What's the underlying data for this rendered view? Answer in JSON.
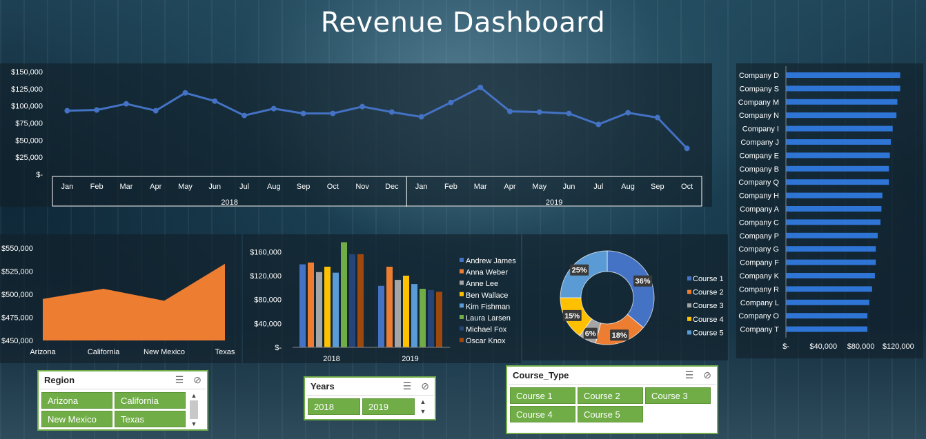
{
  "title": "Revenue Dashboard",
  "colors": {
    "line": "#4472c4",
    "area": "#ed7d31",
    "bars": [
      "#4472c4",
      "#ed7d31",
      "#a5a5a5",
      "#ffc000",
      "#5b9bd5",
      "#70ad47",
      "#264478",
      "#9e480e"
    ],
    "slicer_button": "#70ad47",
    "company_bar": "#2e75d6"
  },
  "line_chart": {
    "type": "line",
    "y_ticks": [
      "$150,000",
      "$125,000",
      "$100,000",
      "$75,000",
      "$50,000",
      "$25,000",
      "$-"
    ],
    "ylim": [
      0,
      150000
    ],
    "months": [
      "Jan",
      "Feb",
      "Mar",
      "Apr",
      "May",
      "Jun",
      "Jul",
      "Aug",
      "Sep",
      "Oct",
      "Nov",
      "Dec",
      "Jan",
      "Feb",
      "Mar",
      "Apr",
      "May",
      "Jun",
      "Jul",
      "Aug",
      "Sep",
      "Oct"
    ],
    "years": [
      "2018",
      "2019"
    ],
    "values": [
      93000,
      94000,
      103000,
      93000,
      119000,
      107000,
      86000,
      96000,
      89000,
      89000,
      99000,
      91000,
      84000,
      105000,
      127000,
      92000,
      91000,
      89000,
      73000,
      90000,
      83000,
      38000
    ]
  },
  "area_chart": {
    "type": "area",
    "y_ticks": [
      "$550,000",
      "$525,000",
      "$500,000",
      "$475,000",
      "$450,000"
    ],
    "ylim": [
      450000,
      550000
    ],
    "categories": [
      "Arizona",
      "California",
      "New Mexico",
      "Texas"
    ],
    "values": [
      495000,
      506000,
      493000,
      533000
    ]
  },
  "bar_chart": {
    "type": "bar",
    "y_ticks": [
      "$160,000",
      "$120,000",
      "$80,000",
      "$40,000",
      "$-"
    ],
    "ylim": [
      0,
      180000
    ],
    "categories": [
      "2018",
      "2019"
    ],
    "series": [
      {
        "name": "Andrew James",
        "values": [
          139000,
          103000
        ]
      },
      {
        "name": "Anna Weber",
        "values": [
          142000,
          135000
        ]
      },
      {
        "name": "Anne Lee",
        "values": [
          126000,
          113000
        ]
      },
      {
        "name": "Ben Wallace",
        "values": [
          135000,
          120000
        ]
      },
      {
        "name": "Kim Fishman",
        "values": [
          125000,
          106000
        ]
      },
      {
        "name": "Laura Larsen",
        "values": [
          176000,
          98000
        ]
      },
      {
        "name": "Michael Fox",
        "values": [
          156000,
          96000
        ]
      },
      {
        "name": "Oscar Knox",
        "values": [
          156000,
          93000
        ]
      }
    ]
  },
  "donut_chart": {
    "type": "pie",
    "labels": [
      "Course 1",
      "Course 2",
      "Course 3",
      "Course 4",
      "Course 5"
    ],
    "values": [
      36,
      18,
      6,
      15,
      25
    ],
    "data_labels": [
      "36%",
      "18%",
      "6%",
      "15%",
      "25%"
    ]
  },
  "company_chart": {
    "type": "bar",
    "categories": [
      "Company D",
      "Company S",
      "Company M",
      "Company N",
      "Company I",
      "Company J",
      "Company E",
      "Company B",
      "Company Q",
      "Company H",
      "Company A",
      "Company C",
      "Company P",
      "Company G",
      "Company F",
      "Company K",
      "Company R",
      "Company L",
      "Company O",
      "Company T"
    ],
    "values": [
      122000,
      122000,
      119000,
      118000,
      114000,
      112000,
      111000,
      110000,
      110000,
      103000,
      102000,
      101000,
      98000,
      96000,
      96000,
      95000,
      92000,
      89000,
      87000,
      87000
    ],
    "x_ticks": [
      "$-",
      "$40,000",
      "$80,000",
      "$120,000"
    ],
    "xlim": [
      0,
      140000
    ]
  },
  "slicers": {
    "region": {
      "title": "Region",
      "items": [
        "Arizona",
        "California",
        "New Mexico",
        "Texas"
      ]
    },
    "years": {
      "title": "Years",
      "items": [
        "2018",
        "2019"
      ]
    },
    "course_type": {
      "title": "Course_Type",
      "items": [
        "Course 1",
        "Course 2",
        "Course 3",
        "Course 4",
        "Course 5"
      ]
    },
    "icons": {
      "multi_select": "multi-select-icon",
      "clear_filter": "clear-filter-icon"
    }
  }
}
